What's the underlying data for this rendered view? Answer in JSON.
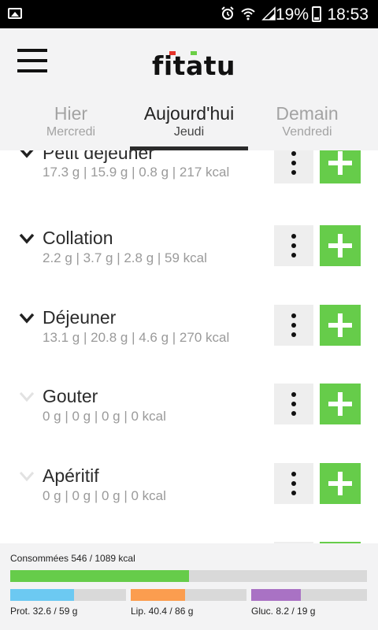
{
  "status_bar": {
    "battery": "19%",
    "time": "18:53",
    "icons": [
      "image-icon",
      "alarm-icon",
      "wifi-icon",
      "signal-icon",
      "battery-icon"
    ]
  },
  "header": {
    "logo_text": "fitatu",
    "tabs": [
      {
        "label": "Hier",
        "sub": "Mercredi",
        "active": false
      },
      {
        "label": "Aujourd'hui",
        "sub": "Jeudi",
        "active": true
      },
      {
        "label": "Demain",
        "sub": "Vendredi",
        "active": false
      }
    ]
  },
  "meals": [
    {
      "name": "Petit déjeuner",
      "macros": "17.3 g | 15.9 g | 0.8 g | 217 kcal",
      "expandable": true
    },
    {
      "name": "Collation",
      "macros": "2.2 g | 3.7 g | 2.8 g | 59 kcal",
      "expandable": true
    },
    {
      "name": "Déjeuner",
      "macros": "13.1 g | 20.8 g | 4.6 g | 270 kcal",
      "expandable": true
    },
    {
      "name": "Gouter",
      "macros": "0 g | 0 g | 0 g | 0 kcal",
      "expandable": false
    },
    {
      "name": "Apéritif",
      "macros": "0 g | 0 g | 0 g | 0 kcal",
      "expandable": false
    }
  ],
  "summary": {
    "consumed_label": "Consommées 546 / 1089 kcal",
    "consumed_fraction": 0.501,
    "protein": {
      "label": "Prot. 32.6 / 59 g",
      "fraction": 0.553,
      "color": "#6cc9f2"
    },
    "lipids": {
      "label": "Lip. 40.4 / 86 g",
      "fraction": 0.47,
      "color": "#fb9d4f"
    },
    "carbs": {
      "label": "Gluc. 8.2 / 19 g",
      "fraction": 0.43,
      "color": "#a972c4"
    },
    "accent_color": "#66cc4a"
  }
}
